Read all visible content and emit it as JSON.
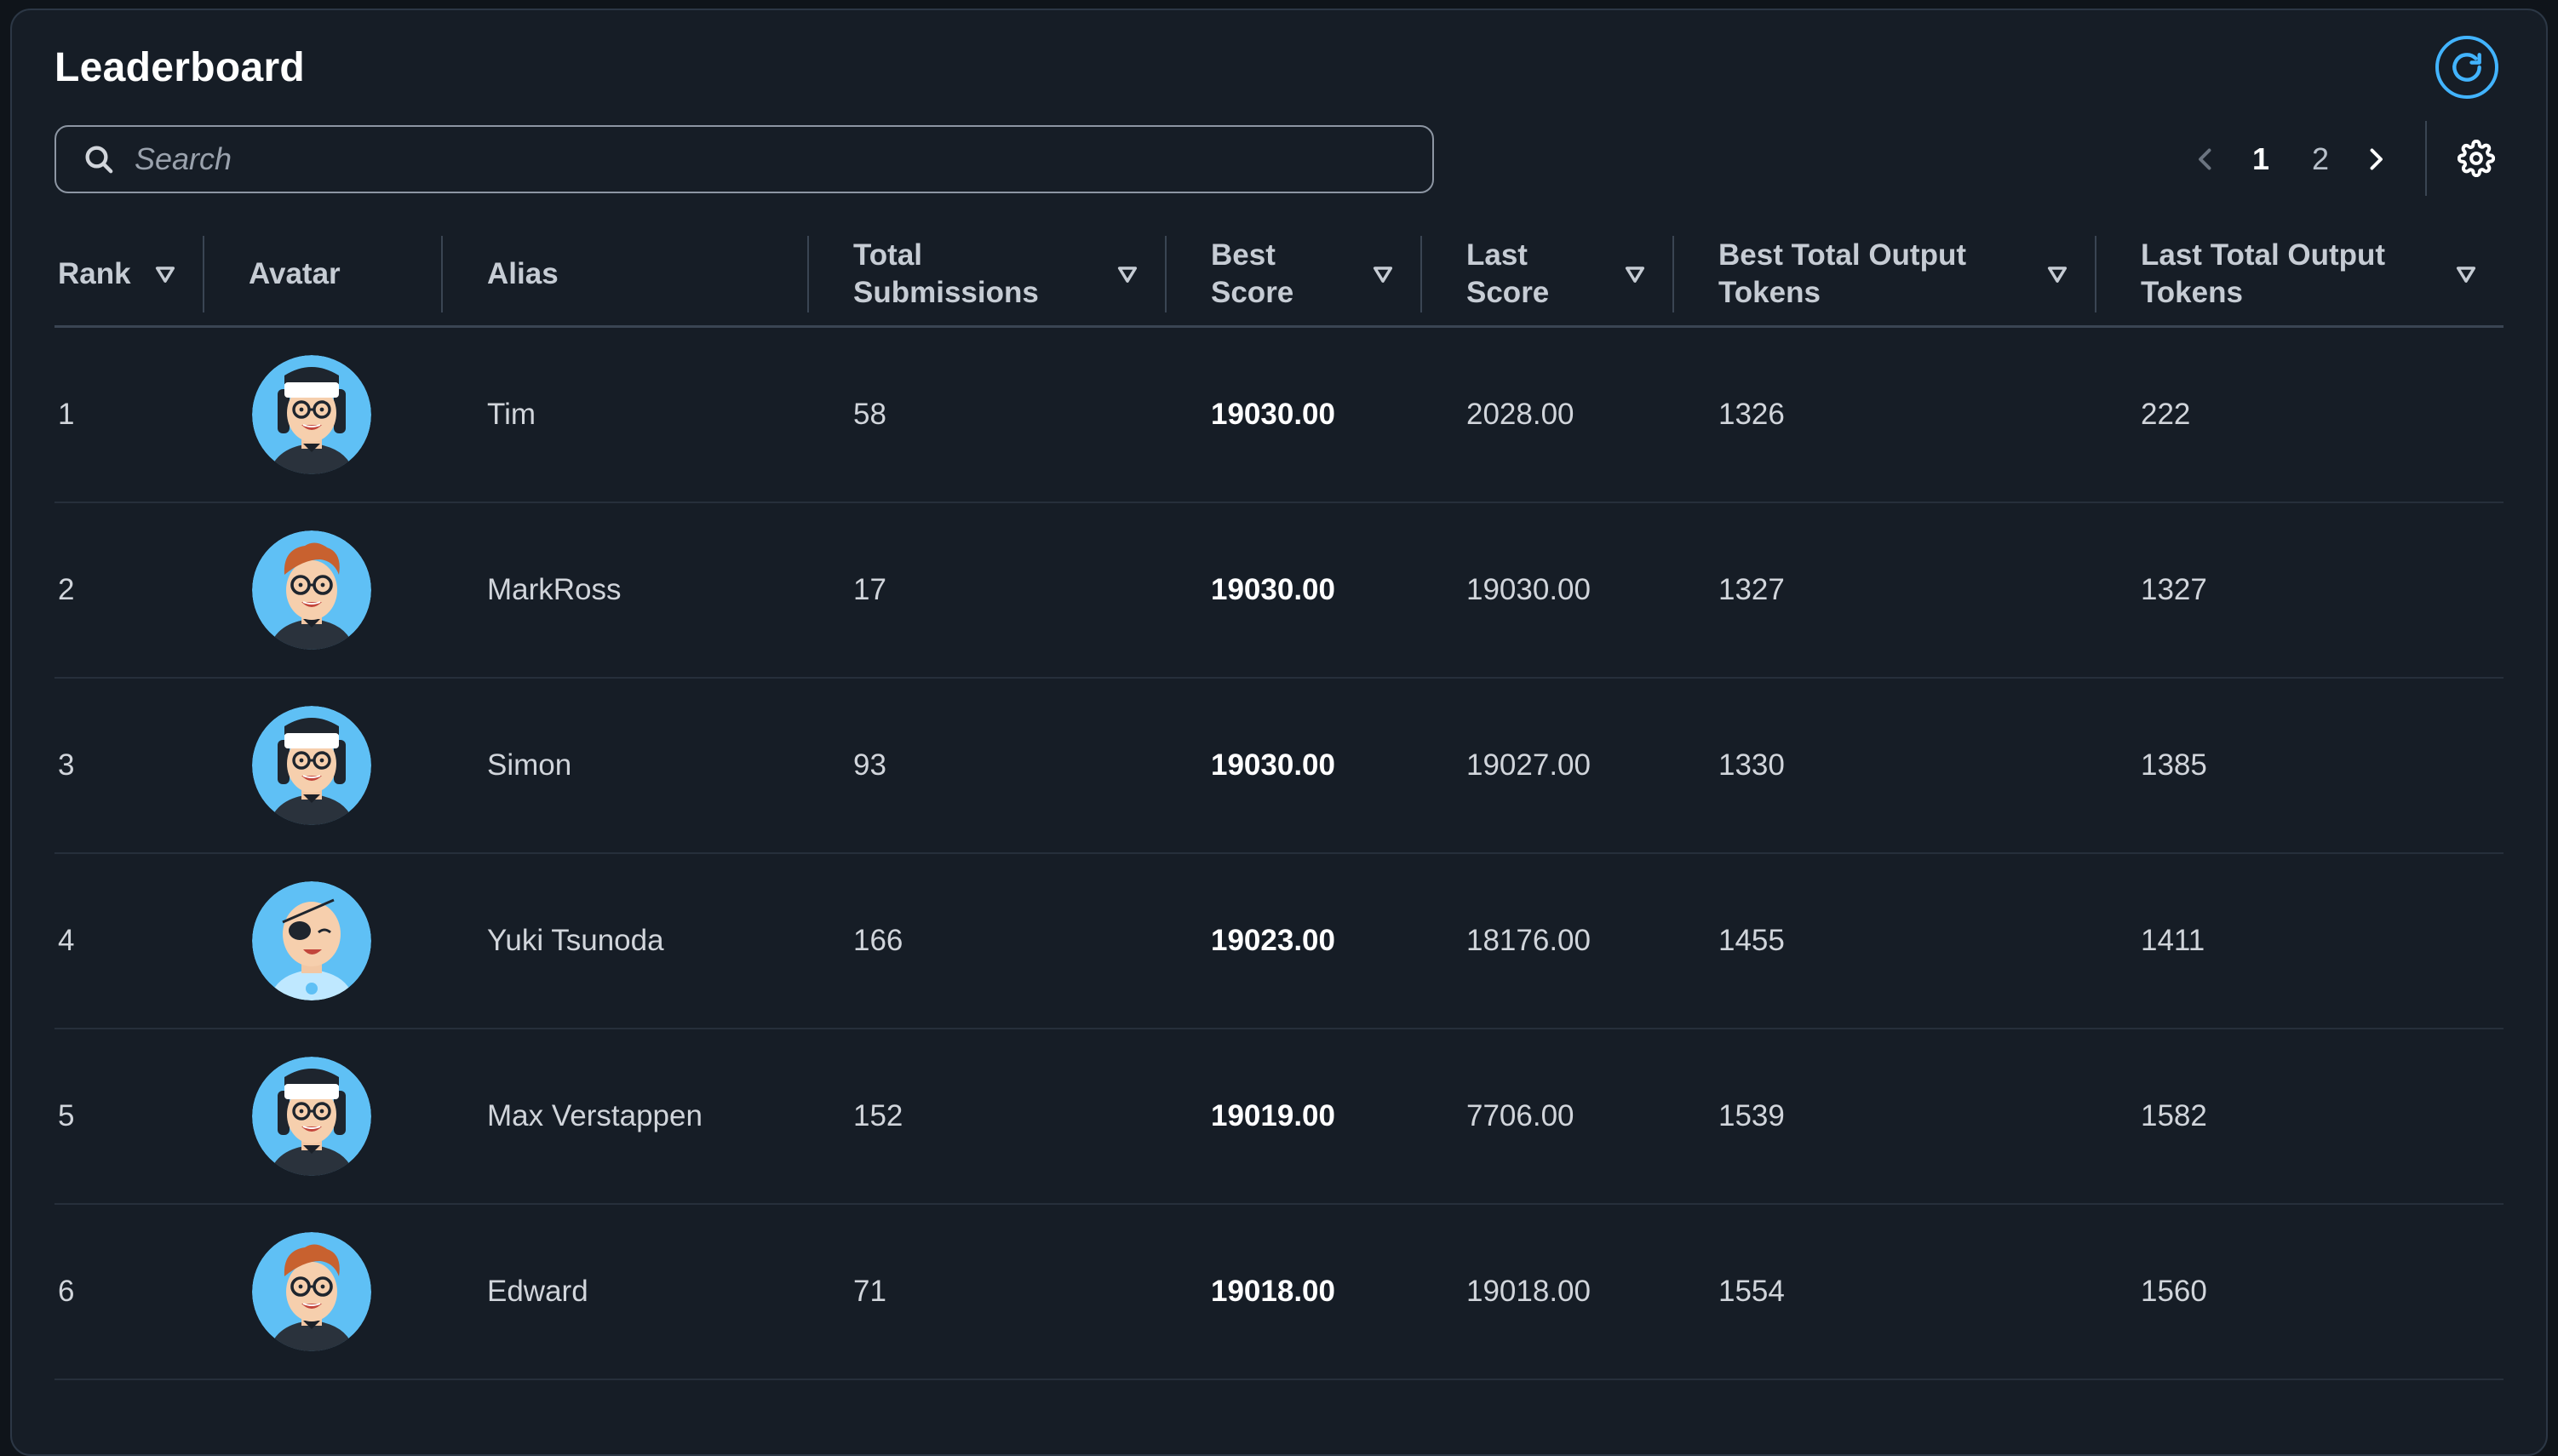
{
  "title": "Leaderboard",
  "search": {
    "placeholder": "Search",
    "value": ""
  },
  "pagination": {
    "pages": [
      "1",
      "2"
    ],
    "current": "1"
  },
  "columns": [
    "Rank",
    "Avatar",
    "Alias",
    "Total Submissions",
    "Best Score",
    "Last Score",
    "Best Total Output Tokens",
    "Last Total Output Tokens"
  ],
  "rows": [
    {
      "rank": "1",
      "avatar": "headband-glasses",
      "alias": "Tim",
      "total_submissions": "58",
      "best_score": "19030.00",
      "last_score": "2028.00",
      "best_tokens": "1326",
      "last_tokens": "222"
    },
    {
      "rank": "2",
      "avatar": "red-hair-glasses",
      "alias": "MarkRoss",
      "total_submissions": "17",
      "best_score": "19030.00",
      "last_score": "19030.00",
      "best_tokens": "1327",
      "last_tokens": "1327"
    },
    {
      "rank": "3",
      "avatar": "headband-glasses",
      "alias": "Simon",
      "total_submissions": "93",
      "best_score": "19030.00",
      "last_score": "19027.00",
      "best_tokens": "1330",
      "last_tokens": "1385"
    },
    {
      "rank": "4",
      "avatar": "eyepatch-bald",
      "alias": "Yuki Tsunoda",
      "total_submissions": "166",
      "best_score": "19023.00",
      "last_score": "18176.00",
      "best_tokens": "1455",
      "last_tokens": "1411"
    },
    {
      "rank": "5",
      "avatar": "headband-glasses",
      "alias": "Max Verstappen",
      "total_submissions": "152",
      "best_score": "19019.00",
      "last_score": "7706.00",
      "best_tokens": "1539",
      "last_tokens": "1582"
    },
    {
      "rank": "6",
      "avatar": "red-hair-glasses",
      "alias": "Edward",
      "total_submissions": "71",
      "best_score": "19018.00",
      "last_score": "19018.00",
      "best_tokens": "1554",
      "last_tokens": "1560"
    }
  ],
  "colors": {
    "background": "#161d26",
    "accent": "#42b4ff",
    "text": "#d1d5db",
    "heading": "#ffffff"
  },
  "icons": {
    "refresh": "refresh-icon",
    "search": "search-icon",
    "prev": "chevron-left-icon",
    "next": "chevron-right-icon",
    "settings": "gear-icon",
    "sort": "sort-down-icon"
  }
}
